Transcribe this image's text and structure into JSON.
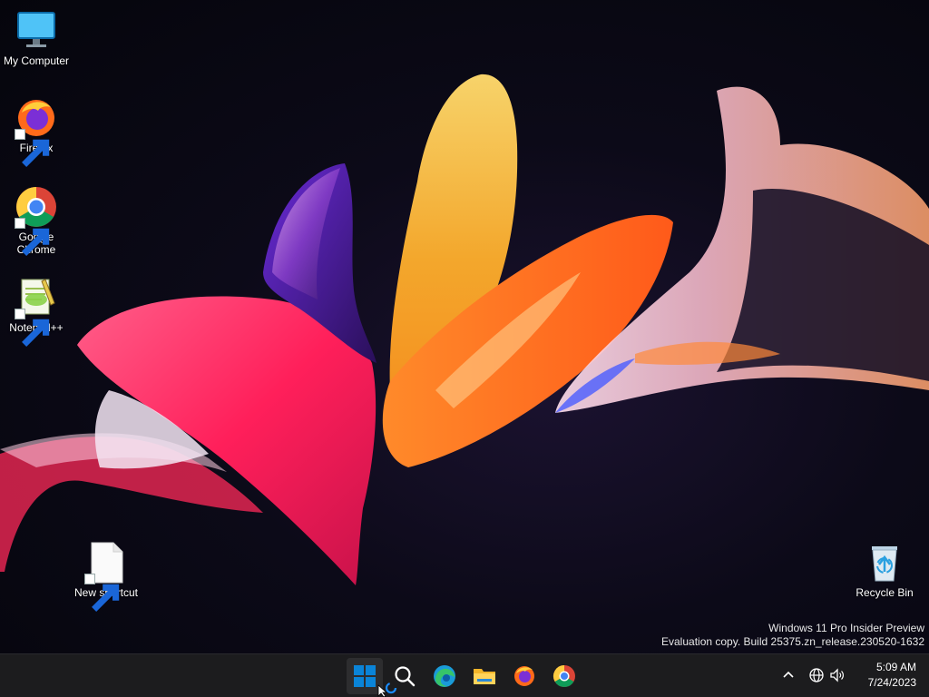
{
  "desktop": {
    "icons": [
      {
        "label": "My Computer",
        "icon": "monitor-icon"
      },
      {
        "label": "Firefox",
        "icon": "firefox-icon"
      },
      {
        "label": "Google Chrome",
        "icon": "chrome-icon"
      },
      {
        "label": "Notepad++",
        "icon": "notepadpp-icon"
      },
      {
        "label": "New shortcut",
        "icon": "blank-file-icon"
      },
      {
        "label": "Recycle Bin",
        "icon": "recycle-bin-icon"
      }
    ]
  },
  "watermark": {
    "line1": "Windows 11 Pro Insider Preview",
    "line2": "Evaluation copy. Build 25375.zn_release.230520-1632"
  },
  "taskbar": {
    "pinned": [
      "start-icon",
      "search-icon",
      "edge-icon",
      "file-explorer-icon",
      "firefox-icon",
      "chrome-icon"
    ],
    "tray": [
      "chevron-up-icon",
      "network-icon",
      "volume-icon"
    ],
    "clock": {
      "time": "5:09 AM",
      "date": "7/24/2023"
    }
  },
  "colors": {
    "taskbar": "#1c1c1e",
    "windows_blue": "#0a84d8"
  }
}
